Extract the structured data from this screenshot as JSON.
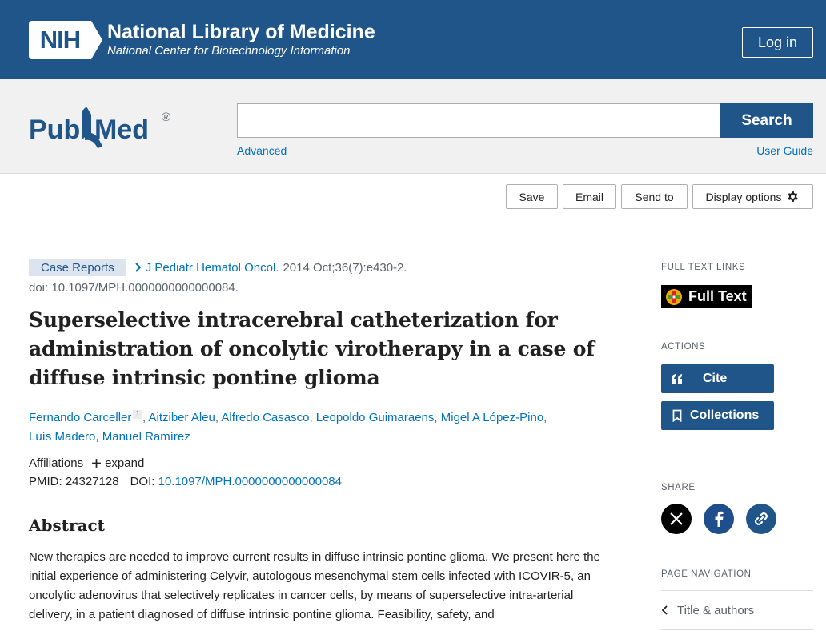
{
  "nih": {
    "abbr": "NIH",
    "title": "National Library of Medicine",
    "subtitle": "National Center for Biotechnology Information",
    "login_label": "Log in"
  },
  "search": {
    "logo_text": "PubMed",
    "placeholder": "",
    "value": "",
    "button_label": "Search",
    "advanced_label": "Advanced",
    "user_guide_label": "User Guide"
  },
  "toolbar": {
    "save_label": "Save",
    "email_label": "Email",
    "send_to_label": "Send to",
    "display_options_label": "Display options"
  },
  "article": {
    "pub_type": "Case Reports",
    "journal": "J Pediatr Hematol Oncol.",
    "citation": "2014 Oct;36(7):e430-2.",
    "doi_line": "doi: 10.1097/MPH.0000000000000084.",
    "title": "Superselective intracerebral catheterization for administration of oncolytic virotherapy in a case of diffuse intrinsic pontine glioma",
    "authors": [
      {
        "name": "Fernando Carceller",
        "sup": "1"
      },
      {
        "name": "Aitziber Aleu"
      },
      {
        "name": "Alfredo Casasco"
      },
      {
        "name": "Leopoldo Guimaraens"
      },
      {
        "name": "Migel A López-Pino"
      },
      {
        "name": "Luís Madero"
      },
      {
        "name": "Manuel Ramírez"
      }
    ],
    "affiliations_label": "Affiliations",
    "expand_label": "expand",
    "pmid_label": "PMID:",
    "pmid": "24327128",
    "doi_label": "DOI:",
    "doi": "10.1097/MPH.0000000000000084",
    "abstract_heading": "Abstract",
    "abstract_text": "New therapies are needed to improve current results in diffuse intrinsic pontine glioma. We present here the initial experience of administering Celyvir, autologous mesenchymal stem cells infected with ICOVIR-5, an oncolytic adenovirus that selectively replicates in cancer cells, by means of superselective intra-arterial delivery, in a patient diagnosed of diffuse intrinsic pontine glioma. Feasibility, safety, and"
  },
  "sidebar": {
    "full_text_heading": "FULL TEXT LINKS",
    "full_text_label": "Full Text",
    "actions_heading": "ACTIONS",
    "cite_label": "Cite",
    "collections_label": "Collections",
    "share_heading": "SHARE",
    "page_nav_heading": "PAGE NAVIGATION",
    "page_nav_items": [
      "Title & authors"
    ]
  },
  "colors": {
    "nih_blue": "#20558a",
    "link_blue": "#0071bc",
    "facebook_blue": "#1e4e8c"
  },
  "icons": [
    "settings-gear-icon",
    "chevron-right-icon",
    "plus-icon",
    "quote-icon",
    "bookmark-icon",
    "x-logo-icon",
    "facebook-icon",
    "link-icon",
    "chevron-left-icon"
  ]
}
